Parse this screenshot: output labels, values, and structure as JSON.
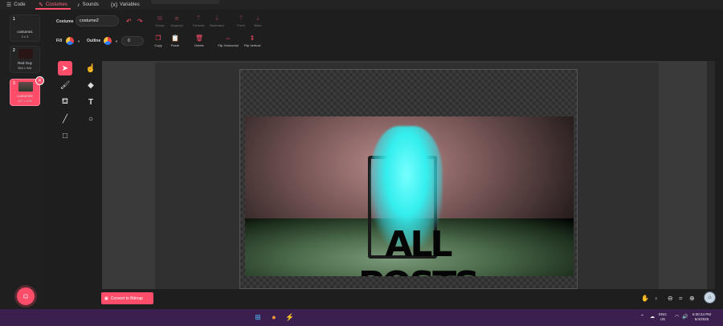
{
  "tabs": [
    {
      "label": "Code",
      "icon": "code-icon"
    },
    {
      "label": "Costumes",
      "icon": "brush-icon"
    },
    {
      "label": "Sounds",
      "icon": "speaker-icon"
    },
    {
      "label": "Variables",
      "icon": "variable-icon"
    }
  ],
  "costumes": [
    {
      "num": "1",
      "name": "costume1",
      "size": "2 x 3"
    },
    {
      "num": "2",
      "name": "Red Guy",
      "size": "564 x 581"
    },
    {
      "num": "3",
      "name": "costume2",
      "size": "487 x 336",
      "selected": true
    }
  ],
  "editor": {
    "costume_label": "Costume",
    "costume_name": "costume2",
    "fill_label": "Fill",
    "outline_label": "Outline",
    "outline_width": "0",
    "group": "Group",
    "ungroup": "Ungroup",
    "forward": "Forward",
    "backward": "Backward",
    "front": "Front",
    "back": "Back",
    "copy": "Copy",
    "paste": "Paste",
    "delete": "Delete",
    "flip_h": "Flip Horizontal",
    "flip_v": "Flip Vertical",
    "convert_bitmap": "Convert to Bitmap"
  },
  "artwork": {
    "text": "ALL POSTS"
  },
  "tray": {
    "lang": "ENG",
    "region": "US",
    "time": "6:30:24 PM",
    "date": "5/4/2025"
  },
  "colors": {
    "accent": "#ff4d6a",
    "taskbar": "#3b1f4f"
  }
}
